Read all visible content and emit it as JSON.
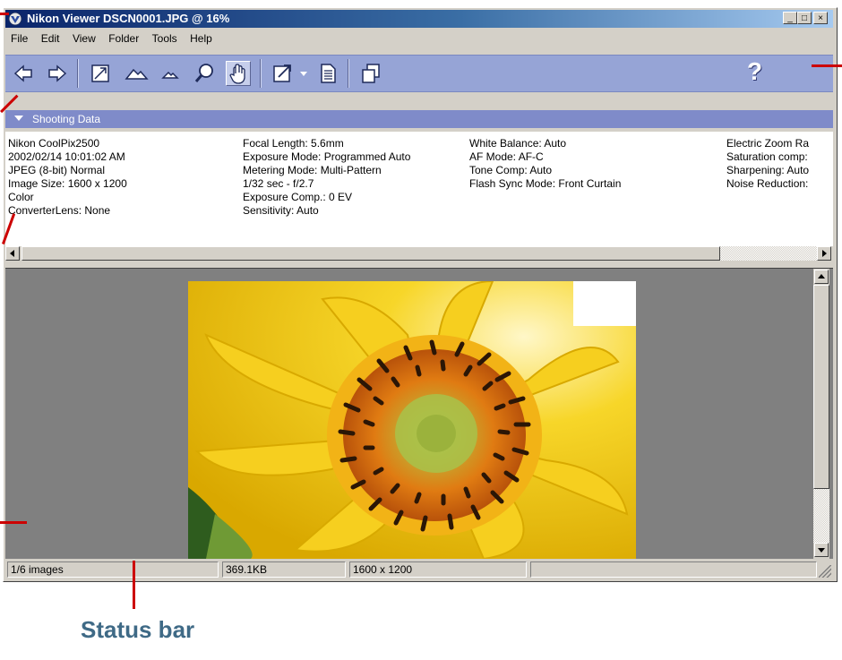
{
  "window": {
    "title": "Nikon Viewer DSCN0001.JPG @ 16%",
    "controls": {
      "minimize": "_",
      "maximize": "□",
      "close": "×"
    }
  },
  "menu": [
    "File",
    "Edit",
    "View",
    "Folder",
    "Tools",
    "Help"
  ],
  "toolbar": {
    "icons": [
      "prev-image",
      "next-image",
      "fit-to-window",
      "zoom-in",
      "zoom-out",
      "magnifier",
      "hand-tool",
      "open-with",
      "dropdown",
      "print",
      "copy"
    ],
    "active": "hand-tool",
    "help_label": "?"
  },
  "shooting_data": {
    "label": "Shooting Data",
    "col1": [
      "Nikon CoolPix2500",
      "2002/02/14 10:01:02 AM",
      "JPEG (8-bit) Normal",
      "Image Size:  1600 x 1200",
      "Color",
      "ConverterLens: None"
    ],
    "col2": [
      "Focal Length: 5.6mm",
      "Exposure Mode: Programmed Auto",
      "Metering Mode: Multi-Pattern",
      "1/32 sec - f/2.7",
      "Exposure Comp.: 0 EV",
      "Sensitivity: Auto"
    ],
    "col3": [
      "White Balance: Auto",
      "AF Mode: AF-C",
      "Tone Comp: Auto",
      "Flash Sync Mode: Front Curtain"
    ],
    "col4": [
      "Electric Zoom Ra",
      "Saturation comp:",
      "Sharpening: Auto",
      "Noise Reduction:"
    ]
  },
  "status": {
    "images": "1/6 images",
    "size": "369.1KB",
    "dimensions": "1600 x 1200",
    "extra": ""
  },
  "caption": "Status bar",
  "colors": {
    "titlebar_start": "#0a246a",
    "toolbar": "#96a4d6",
    "section": "#7f8bc9",
    "callout": "#cc0000",
    "caption": "#3f6a86"
  }
}
